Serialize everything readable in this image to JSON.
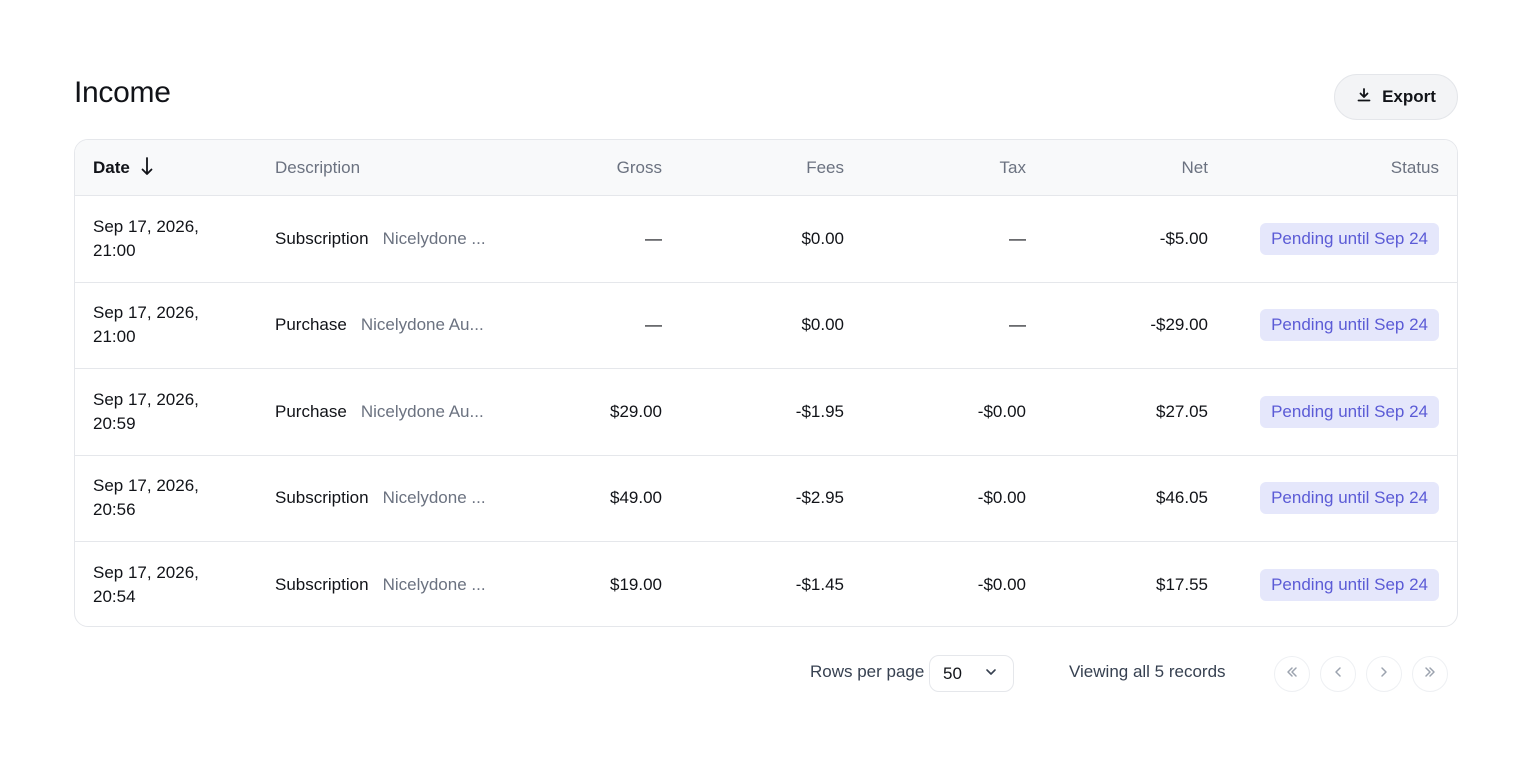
{
  "page": {
    "title": "Income"
  },
  "toolbar": {
    "export_label": "Export",
    "export_icon": "download-icon"
  },
  "table": {
    "columns": {
      "date": "Date",
      "description": "Description",
      "gross": "Gross",
      "fees": "Fees",
      "tax": "Tax",
      "net": "Net",
      "status": "Status"
    },
    "sort": {
      "column": "date",
      "direction": "descending",
      "icon": "arrow-down-icon"
    },
    "rows": [
      {
        "date_line1": "Sep 17, 2026,",
        "date_line2": "21:00",
        "type": "Subscription",
        "name": "Nicelydone ...",
        "gross": "—",
        "fees": "$0.00",
        "tax": "—",
        "net": "-$5.00",
        "status": "Pending until Sep 24"
      },
      {
        "date_line1": "Sep 17, 2026,",
        "date_line2": "21:00",
        "type": "Purchase",
        "name": "Nicelydone Au...",
        "gross": "—",
        "fees": "$0.00",
        "tax": "—",
        "net": "-$29.00",
        "status": "Pending until Sep 24"
      },
      {
        "date_line1": "Sep 17, 2026,",
        "date_line2": "20:59",
        "type": "Purchase",
        "name": "Nicelydone Au...",
        "gross": "$29.00",
        "fees": "-$1.95",
        "tax": "-$0.00",
        "net": "$27.05",
        "status": "Pending until Sep 24"
      },
      {
        "date_line1": "Sep 17, 2026,",
        "date_line2": "20:56",
        "type": "Subscription",
        "name": "Nicelydone ...",
        "gross": "$49.00",
        "fees": "-$2.95",
        "tax": "-$0.00",
        "net": "$46.05",
        "status": "Pending until Sep 24"
      },
      {
        "date_line1": "Sep 17, 2026,",
        "date_line2": "20:54",
        "type": "Subscription",
        "name": "Nicelydone ...",
        "gross": "$19.00",
        "fees": "-$1.45",
        "tax": "-$0.00",
        "net": "$17.55",
        "status": "Pending until Sep 24"
      }
    ]
  },
  "pagination": {
    "rows_per_page_label": "Rows per page",
    "rows_per_page_value": "50",
    "records_text": "Viewing all 5 records",
    "icons": [
      "chevrons-left-icon",
      "chevron-left-icon",
      "chevron-right-icon",
      "chevrons-right-icon"
    ]
  },
  "colors": {
    "badge_bg": "#e5e7fb",
    "badge_text": "#5b5bd6",
    "muted_text": "#6b7280"
  }
}
